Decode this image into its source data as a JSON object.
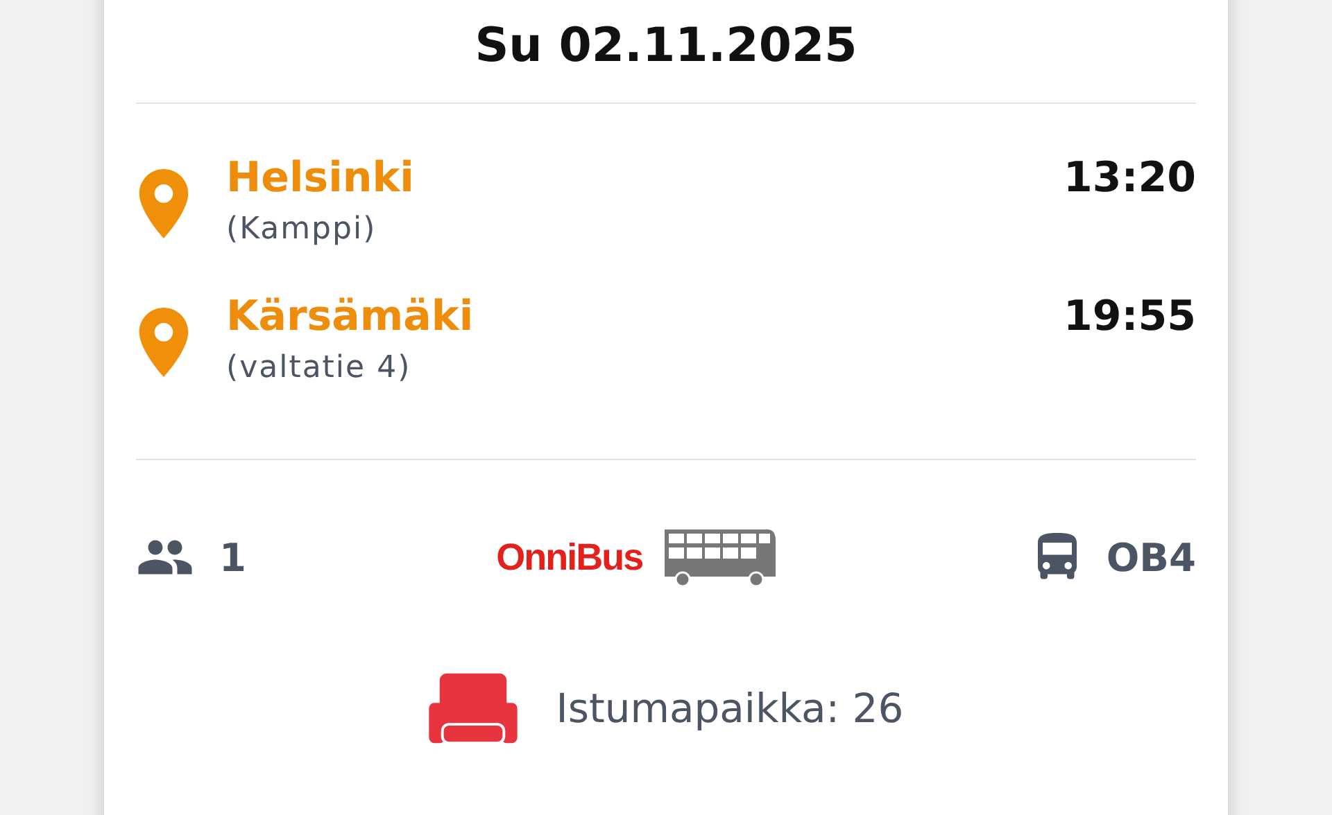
{
  "date": "Su 02.11.2025",
  "stops": [
    {
      "name": "Helsinki",
      "detail": "(Kamppi)",
      "time": "13:20"
    },
    {
      "name": "Kärsämäki",
      "detail": "(valtatie 4)",
      "time": "19:55"
    }
  ],
  "passengers": "1",
  "operator": "OnniBus",
  "line": "OB4",
  "seat": "Istumapaikka: 26"
}
